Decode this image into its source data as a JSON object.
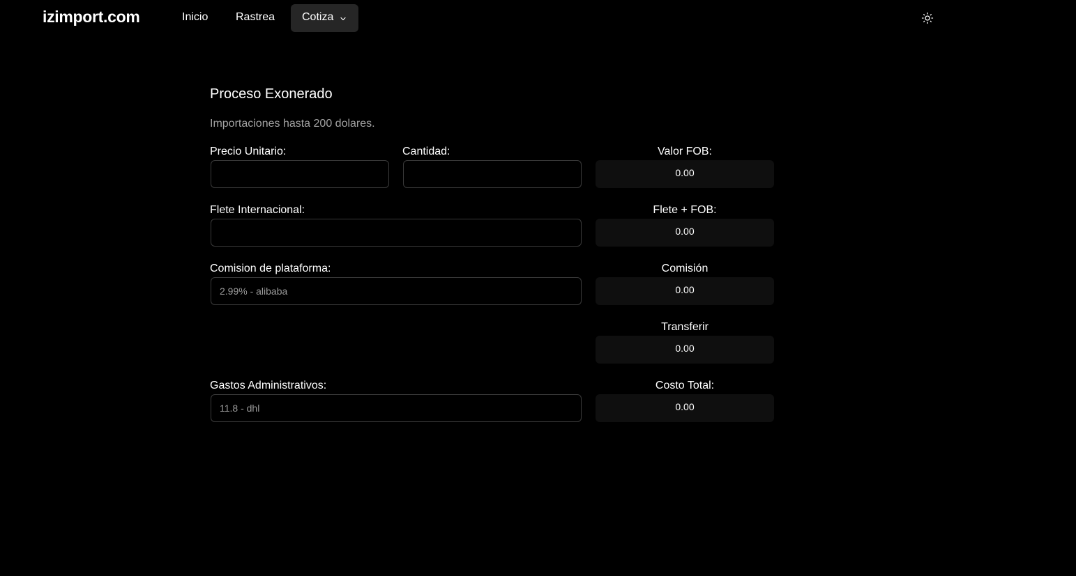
{
  "header": {
    "brand": "izimport.com",
    "nav": {
      "inicio": "Inicio",
      "rastrea": "Rastrea",
      "cotiza": "Cotiza"
    },
    "theme_icon": "sun-icon"
  },
  "main": {
    "title": "Proceso Exonerado",
    "subtitle": "Importaciones hasta 200 dolares.",
    "fields": {
      "precio_unitario": {
        "label": "Precio Unitario:",
        "value": ""
      },
      "cantidad": {
        "label": "Cantidad:",
        "value": ""
      },
      "flete_internacional": {
        "label": "Flete Internacional:",
        "value": ""
      },
      "comision_plataforma": {
        "label": "Comision de plataforma:",
        "placeholder": "2.99% - alibaba"
      },
      "gastos_administrativos": {
        "label": "Gastos Administrativos:",
        "placeholder": "11.8 - dhl"
      }
    },
    "outputs": {
      "valor_fob": {
        "label": "Valor FOB:",
        "value": "0.00"
      },
      "flete_fob": {
        "label": "Flete + FOB:",
        "value": "0.00"
      },
      "comision": {
        "label": "Comisión",
        "value": "0.00"
      },
      "transferir": {
        "label": "Transferir",
        "value": "0.00"
      },
      "costo_total": {
        "label": "Costo Total:",
        "value": "0.00"
      }
    }
  }
}
